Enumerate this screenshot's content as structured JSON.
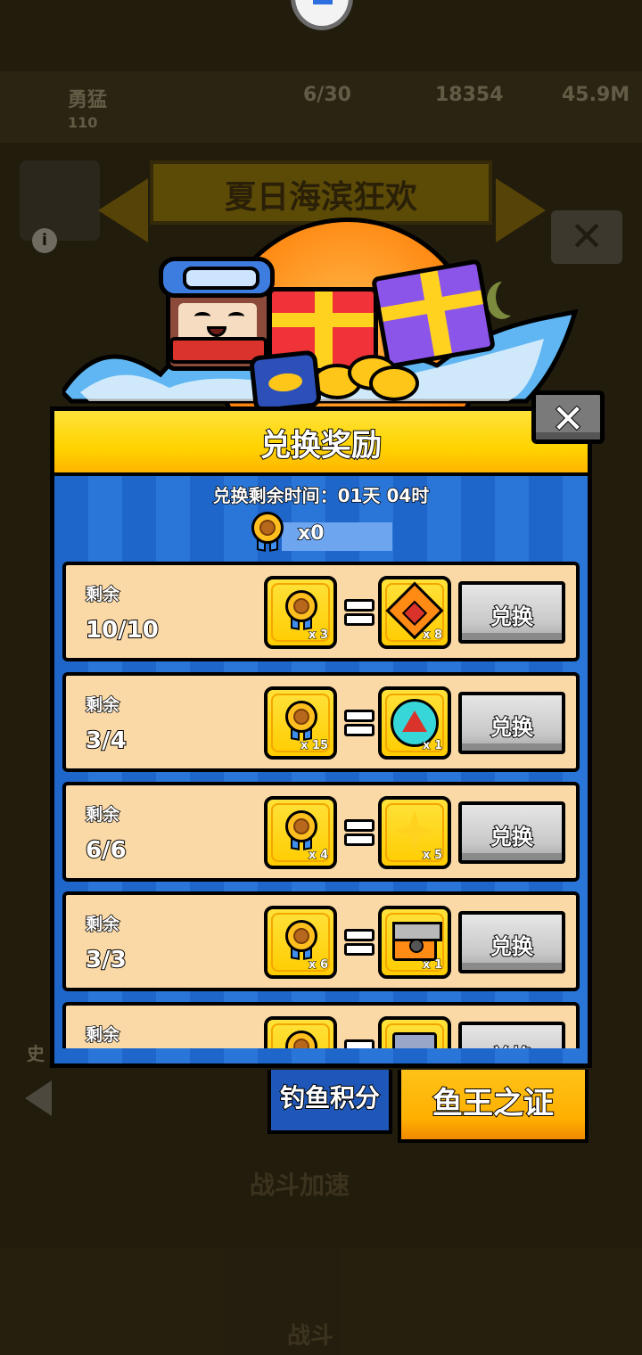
{
  "background": {
    "player_name": "勇猛",
    "player_level": "110",
    "energy": "6/30",
    "gems": "18354",
    "coins": "45.9M",
    "event_title": "夏日海滨狂欢",
    "battle_boost": "战斗加速",
    "battle_tab": "战斗",
    "side_label": "史"
  },
  "modal": {
    "title": "兑换奖励",
    "close_glyph": "✕",
    "time_label": "兑换剩余时间：01天 04时",
    "balance": "x0"
  },
  "rows": [
    {
      "label": "剩余",
      "count": "10/10",
      "cost": "x 3",
      "reward": "scroll",
      "reward_qty": "x 8",
      "button": "兑换"
    },
    {
      "label": "剩余",
      "count": "3/4",
      "cost": "x 15",
      "reward": "seal",
      "reward_qty": "x 1",
      "button": "兑换"
    },
    {
      "label": "剩余",
      "count": "6/6",
      "cost": "x 4",
      "reward": "star",
      "reward_qty": "x 5",
      "button": "兑换"
    },
    {
      "label": "剩余",
      "count": "3/3",
      "cost": "x 6",
      "reward": "chest",
      "reward_qty": "x 1",
      "button": "兑换"
    },
    {
      "label": "剩余",
      "count": "",
      "cost": "",
      "reward": "chest2",
      "reward_qty": "",
      "button": "兑换"
    }
  ],
  "tabs": {
    "points": "钓鱼积分",
    "certificate": "鱼王之证"
  },
  "colors": {
    "header_yellow": "#ffd400",
    "body_blue": "#1e66c9",
    "row_bg": "#fbd9a6",
    "tab_blue": "#1e57b8",
    "tab_orange": "#ffb000"
  }
}
